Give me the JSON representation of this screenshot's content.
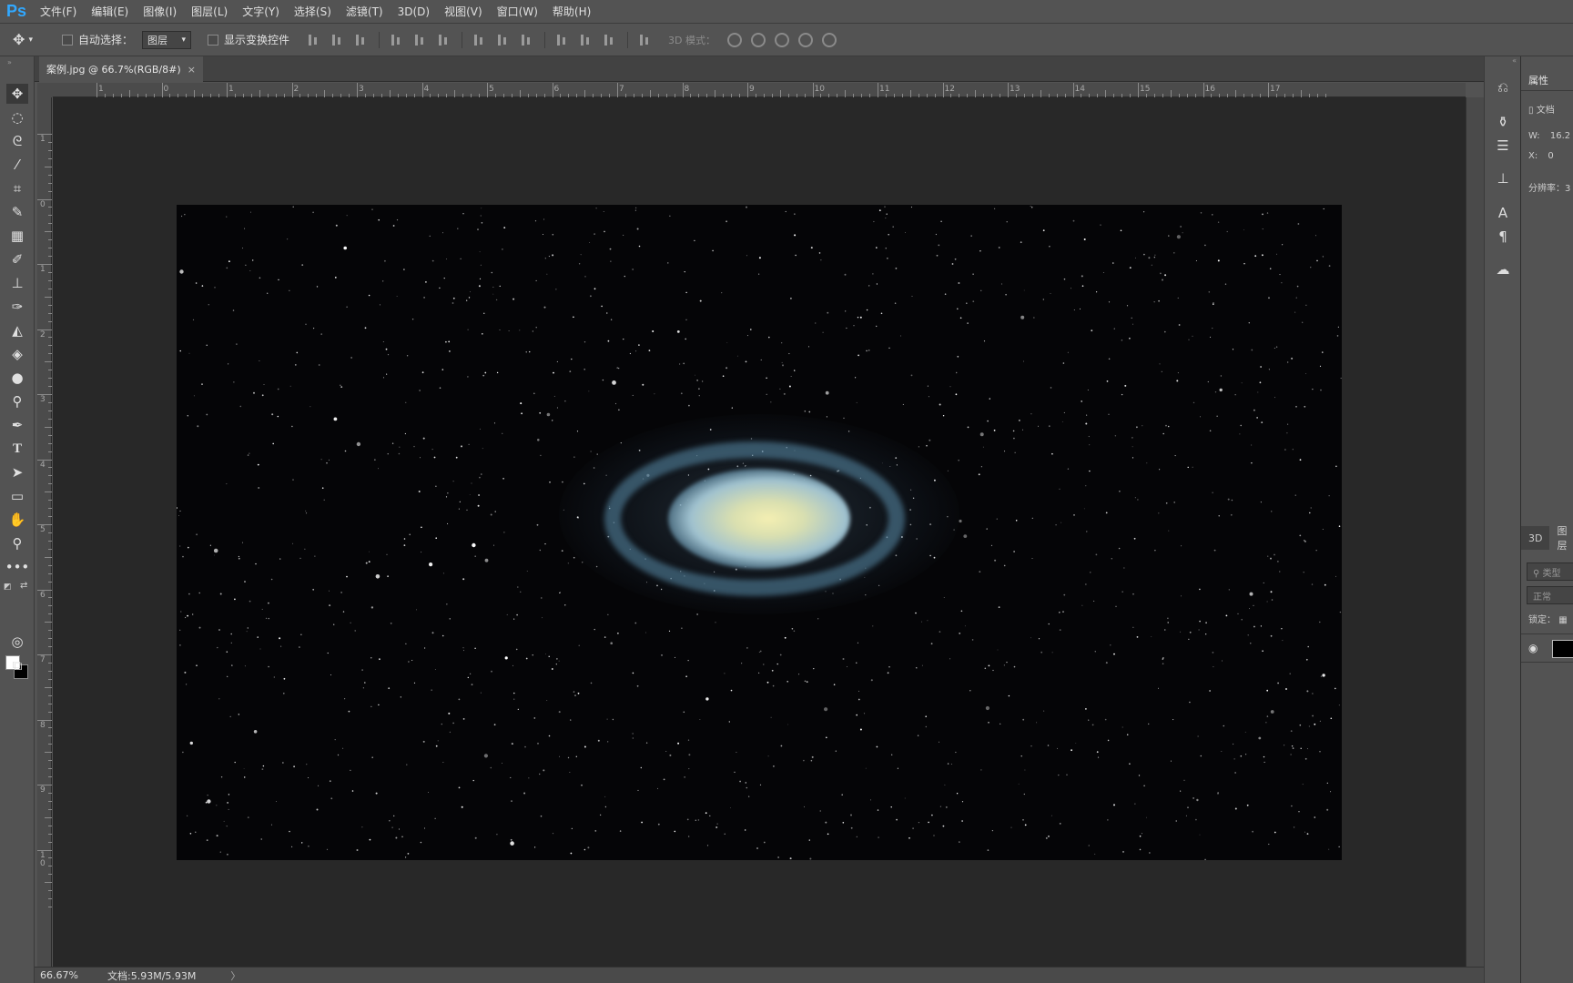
{
  "app": {
    "logo": "Ps",
    "menu": [
      "文件(F)",
      "编辑(E)",
      "图像(I)",
      "图层(L)",
      "文字(Y)",
      "选择(S)",
      "滤镜(T)",
      "3D(D)",
      "视图(V)",
      "窗口(W)",
      "帮助(H)"
    ]
  },
  "options_bar": {
    "auto_select_label": "自动选择：",
    "auto_select_value": "图层",
    "show_transform_label": "显示变换控件",
    "mode_3d_label": "3D 模式："
  },
  "document": {
    "tab_title": "案例.jpg @ 66.7%(RGB/8#)",
    "close_glyph": "×"
  },
  "rulers": {
    "h_labels": [
      "1",
      "0",
      "1",
      "2",
      "3",
      "4",
      "5",
      "6",
      "7",
      "8",
      "9",
      "10",
      "11",
      "12",
      "13",
      "14",
      "15",
      "16",
      "17"
    ],
    "v_labels": [
      "1",
      "0",
      "1",
      "2",
      "3",
      "4",
      "5",
      "6",
      "7",
      "8",
      "9",
      "1\n0"
    ]
  },
  "status": {
    "zoom": "66.67%",
    "doc_size": "文档:5.93M/5.93M",
    "arrow": "〉"
  },
  "properties_panel": {
    "tab": "属性",
    "doc_label": "文档",
    "w_label": "W:",
    "w_value": "16.2",
    "x_label": "X:",
    "x_value": "0",
    "resolution_label": "分辨率：3"
  },
  "layers_panel": {
    "tab_3d": "3D",
    "tab_layers": "图层",
    "search_placeholder": "类型",
    "blend_mode": "正常",
    "lock_label": "锁定："
  },
  "colors": {
    "ui_bg": "#535353",
    "canvas_bg": "#282828",
    "ps_blue": "#31a8ff"
  }
}
